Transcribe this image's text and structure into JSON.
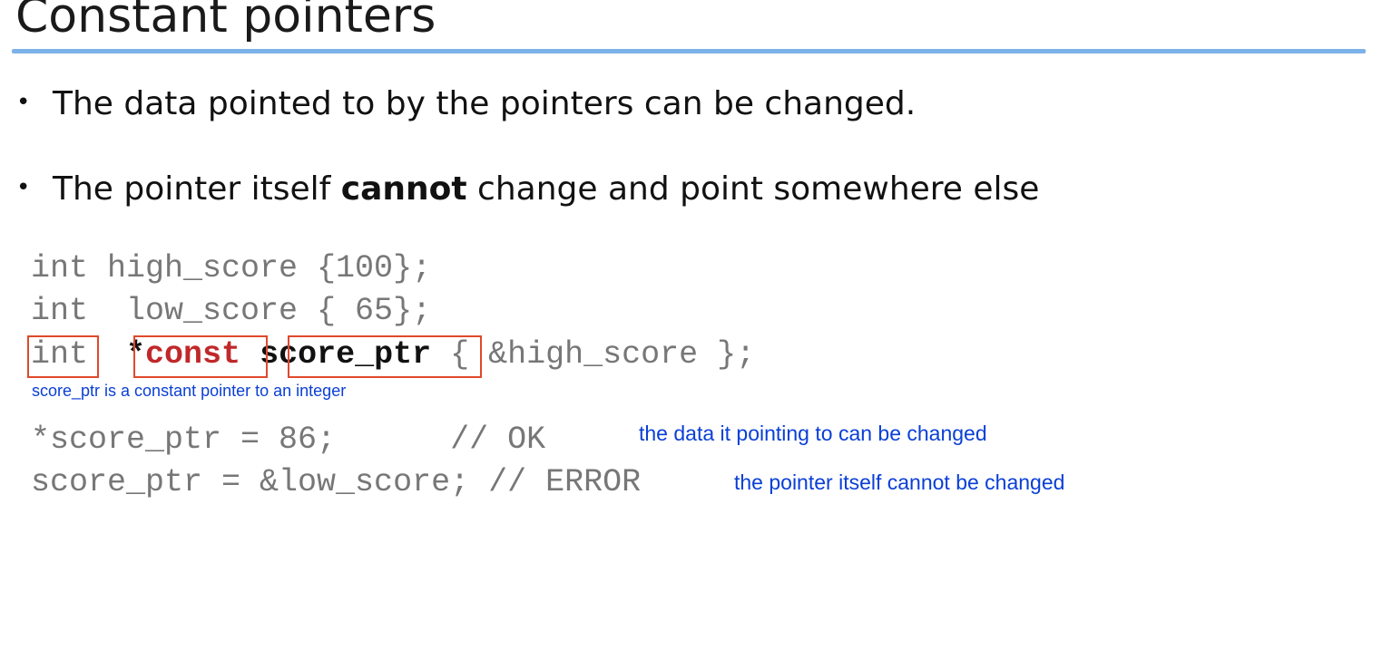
{
  "slide": {
    "title": "Constant pointers",
    "bullets": [
      {
        "text": "The data pointed to by the pointers can be changed."
      },
      {
        "before": "The pointer itself ",
        "emphasis": "cannot",
        "after": " change and point somewhere else"
      }
    ],
    "bullet_glyph": "•",
    "code": {
      "line1": "int high_score {100};",
      "line2": "int  low_score { 65};",
      "line3": {
        "type": "int",
        "gap1": "  ",
        "star": "*",
        "const": "const",
        "gap2": " ",
        "name": "score_ptr",
        "rest": " { &high_score };"
      },
      "line4": "*score_ptr = 86;      // OK",
      "line5": "score_ptr = &low_score; // ERROR"
    },
    "annotations": {
      "declaration_note": "score_ptr is a constant pointer to an integer",
      "ok_note": "the data it pointing to can be changed",
      "error_note": "the pointer itself cannot be changed"
    },
    "colors": {
      "title_rule": "#7cb2e8",
      "highlight_box": "#e0492c",
      "const_keyword": "#c0282a",
      "annotation_text": "#0a3fd6",
      "code_text": "#777777"
    }
  }
}
